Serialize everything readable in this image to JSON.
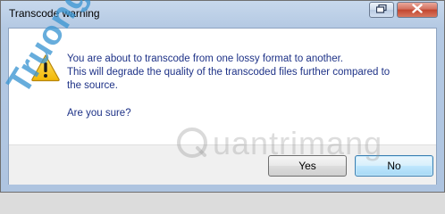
{
  "window": {
    "title": "Transcode warning"
  },
  "message": {
    "lines": [
      "You are about to transcode from one lossy format to another.",
      "This will degrade the quality of the transcoded files further compared to",
      "the source."
    ],
    "question": "Are you sure?"
  },
  "buttons": {
    "yes": "Yes",
    "no": "No"
  },
  "icons": {
    "warning": "warning-icon",
    "restore": "restore-icon",
    "close": "close-icon"
  },
  "watermark": {
    "logo_text": "uantrimang",
    "diagonal_text": "Truongin.tom"
  },
  "colors": {
    "message_text": "#1e3287",
    "titlebar": "#b4c9e3",
    "close_button": "#c2462f",
    "default_button_border": "#3c7fb1"
  }
}
